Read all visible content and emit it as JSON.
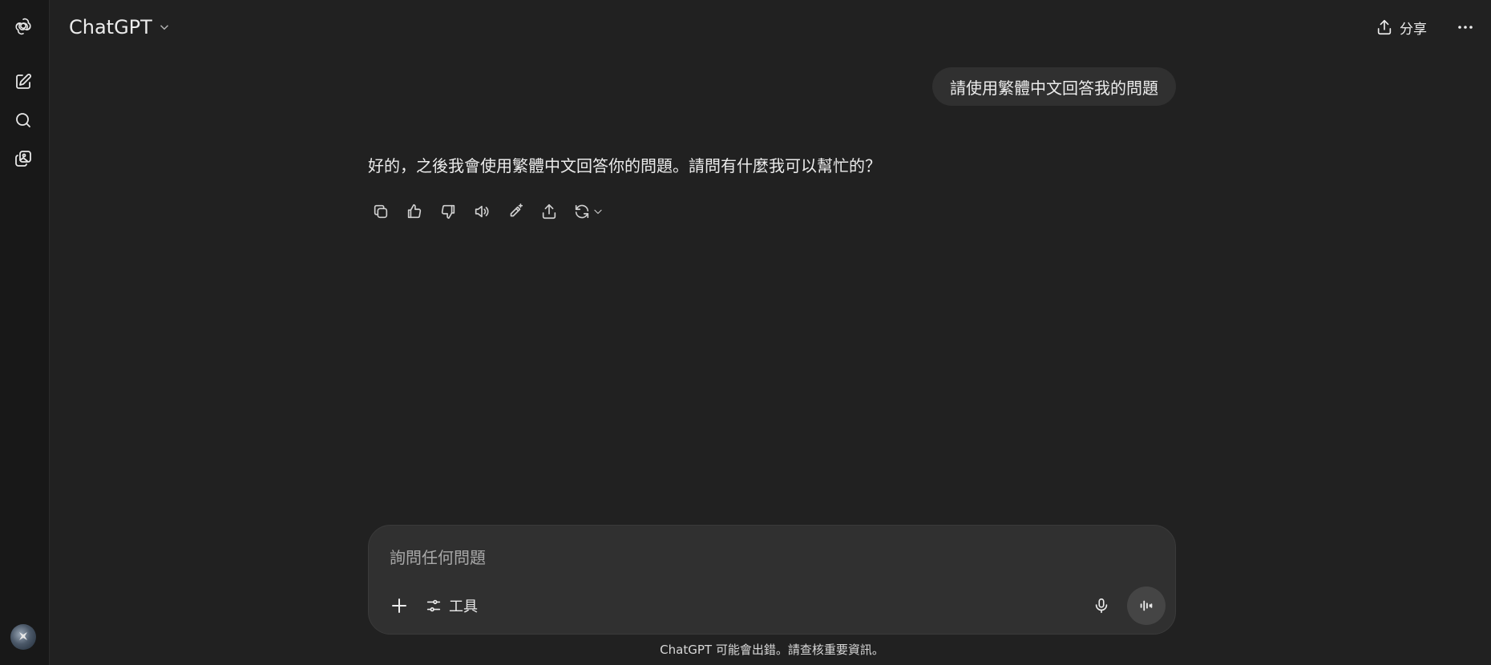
{
  "header": {
    "model_name": "ChatGPT",
    "share_label": "分享"
  },
  "sidebar": {
    "items": [
      {
        "name": "new-chat",
        "icon": "edit-icon"
      },
      {
        "name": "search",
        "icon": "search-icon"
      },
      {
        "name": "library",
        "icon": "images-icon"
      }
    ]
  },
  "conversation": {
    "user_message": "請使用繁體中文回答我的問題",
    "assistant_message": "好的，之後我會使用繁體中文回答你的問題。請問有什麼我可以幫忙的？",
    "actions": [
      "copy-icon",
      "thumbs-up-icon",
      "thumbs-down-icon",
      "read-aloud-icon",
      "edit-icon",
      "share-icon",
      "regenerate-icon"
    ]
  },
  "composer": {
    "placeholder": "詢問任何問題",
    "tools_label": "工具"
  },
  "footer": {
    "disclaimer": "ChatGPT 可能會出錯。請查核重要資訊。"
  },
  "colors": {
    "background": "#212121",
    "sidebar": "#181818",
    "bubble": "#303030",
    "text": "#ececec"
  }
}
